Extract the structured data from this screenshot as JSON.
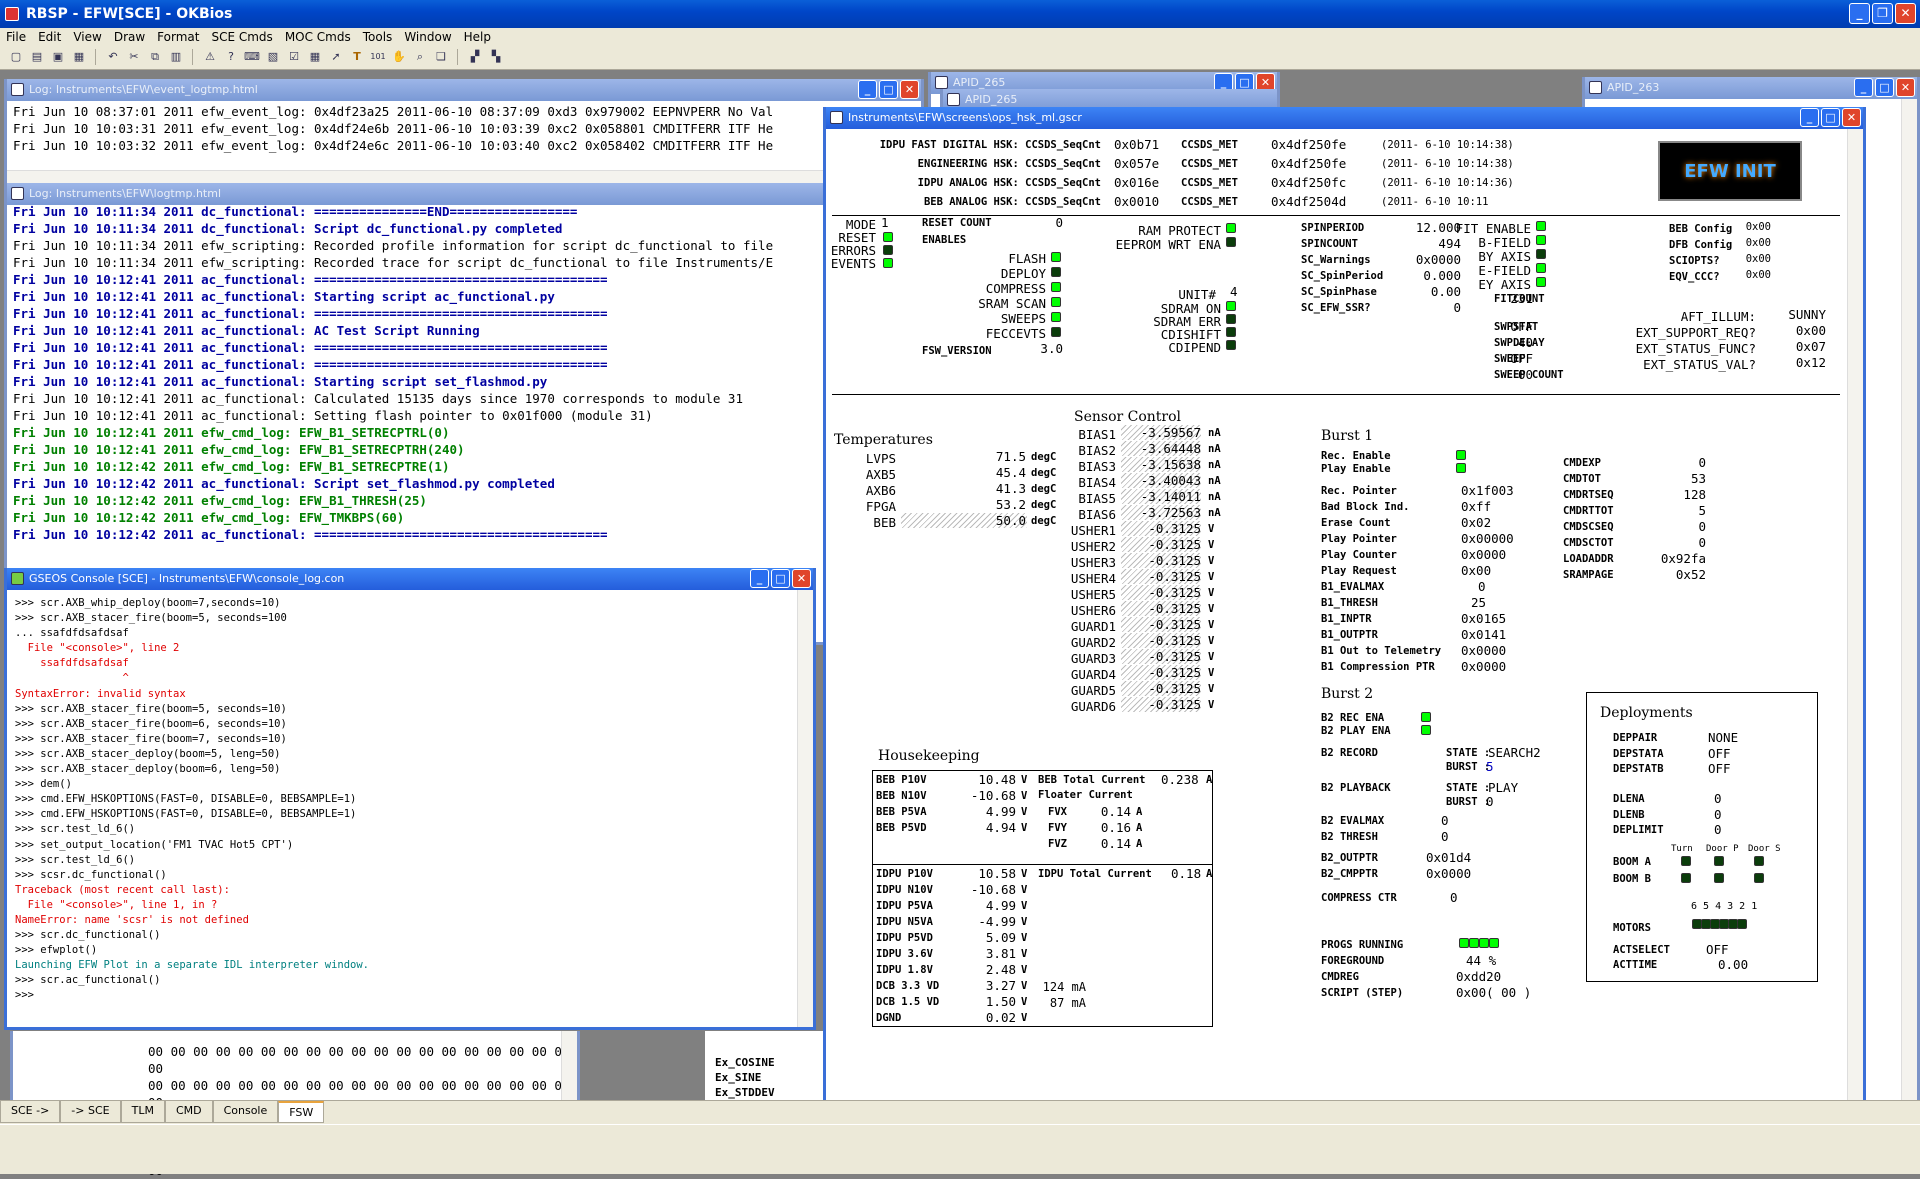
{
  "app": {
    "title": "RBSP - EFW[SCE] - OKBios",
    "menu": [
      "File",
      "Edit",
      "View",
      "Draw",
      "Format",
      "SCE Cmds",
      "MOC Cmds",
      "Tools",
      "Window",
      "Help"
    ]
  },
  "tabs": [
    "SCE ->",
    "-> SCE",
    "TLM",
    "CMD",
    "Console",
    "FSW"
  ],
  "event_log": {
    "title": "Log: Instruments\\EFW\\event_logtmp.html",
    "lines": [
      "Fri Jun 10 08:37:01 2011 efw_event_log: 0x4df23a25 2011-06-10 08:37:09 0xd3 0x979002 EEPNVPERR No Val",
      "Fri Jun 10 10:03:31 2011 efw_event_log: 0x4df24e6b 2011-06-10 10:03:39 0xc2 0x058801 CMDITFERR ITF He",
      "Fri Jun 10 10:03:32 2011 efw_event_log: 0x4df24e6c 2011-06-10 10:03:40 0xc2 0x058402 CMDITFERR ITF He"
    ]
  },
  "logtmp": {
    "title": "Log: Instruments\\EFW\\logtmp.html",
    "lines": [
      {
        "c": "blue",
        "t": "Fri Jun 10 10:11:34 2011 dc_functional: ===============END================="
      },
      {
        "c": "blue",
        "t": "Fri Jun 10 10:11:34 2011 dc_functional: Script dc_functional.py completed"
      },
      {
        "c": "blk",
        "t": "Fri Jun 10 10:11:34 2011 efw_scripting: Recorded profile information for script dc_functional to file"
      },
      {
        "c": "blk",
        "t": "Fri Jun 10 10:11:34 2011 efw_scripting: Recorded trace for script dc_functional to file Instruments/E"
      },
      {
        "c": "blue",
        "t": "Fri Jun 10 10:12:41 2011 ac_functional: ======================================="
      },
      {
        "c": "blue",
        "t": "Fri Jun 10 10:12:41 2011 ac_functional: Starting script ac_functional.py"
      },
      {
        "c": "blue",
        "t": "Fri Jun 10 10:12:41 2011 ac_functional: ======================================="
      },
      {
        "c": "blue",
        "t": "Fri Jun 10 10:12:41 2011 ac_functional: AC Test Script Running"
      },
      {
        "c": "blue",
        "t": "Fri Jun 10 10:12:41 2011 ac_functional: ======================================="
      },
      {
        "c": "blue",
        "t": "Fri Jun 10 10:12:41 2011 ac_functional: ======================================="
      },
      {
        "c": "blue",
        "t": "Fri Jun 10 10:12:41 2011 ac_functional: Starting script set_flashmod.py"
      },
      {
        "c": "blk",
        "t": "Fri Jun 10 10:12:41 2011 ac_functional: Calculated 15135 days since 1970 corresponds to module 31"
      },
      {
        "c": "blk",
        "t": "Fri Jun 10 10:12:41 2011 ac_functional: Setting flash pointer to 0x01f000 (module 31)"
      },
      {
        "c": "green",
        "t": "Fri Jun 10 10:12:41 2011 efw_cmd_log: EFW_B1_SETRECPTRL(0)"
      },
      {
        "c": "green",
        "t": "Fri Jun 10 10:12:41 2011 efw_cmd_log: EFW_B1_SETRECPTRH(240)"
      },
      {
        "c": "green",
        "t": "Fri Jun 10 10:12:42 2011 efw_cmd_log: EFW_B1_SETRECPTRE(1)"
      },
      {
        "c": "blue",
        "t": "Fri Jun 10 10:12:42 2011 ac_functional: Script set_flashmod.py completed"
      },
      {
        "c": "green",
        "t": "Fri Jun 10 10:12:42 2011 efw_cmd_log: EFW_B1_THRESH(25)"
      },
      {
        "c": "green",
        "t": "Fri Jun 10 10:12:42 2011 efw_cmd_log: EFW_TMKBPS(60)"
      },
      {
        "c": "blue",
        "t": "Fri Jun 10 10:12:42 2011 ac_functional: ======================================="
      }
    ]
  },
  "console": {
    "title": "GSEOS Console  [SCE] - Instruments\\EFW\\console_log.con",
    "lines": [
      {
        "c": "blk",
        "t": ">>> scr.AXB_whip_deploy(boom=7,seconds=10)"
      },
      {
        "c": "blk",
        "t": ">>> scr.AXB_stacer_fire(boom=5, seconds=100"
      },
      {
        "c": "blk",
        "t": "... ssafdfdsafdsaf"
      },
      {
        "c": "red",
        "t": "  File \"<console>\", line 2"
      },
      {
        "c": "red",
        "t": "    ssafdfdsafdsaf"
      },
      {
        "c": "red",
        "t": "                 ^"
      },
      {
        "c": "red",
        "t": "SyntaxError: invalid syntax"
      },
      {
        "c": "blk",
        "t": ">>> scr.AXB_stacer_fire(boom=5, seconds=10)"
      },
      {
        "c": "blk",
        "t": ">>> scr.AXB_stacer_fire(boom=6, seconds=10)"
      },
      {
        "c": "blk",
        "t": ">>> scr.AXB_stacer_fire(boom=7, seconds=10)"
      },
      {
        "c": "blk",
        "t": ">>> scr.AXB_stacer_deploy(boom=5, leng=50)"
      },
      {
        "c": "blk",
        "t": ">>> scr.AXB_stacer_deploy(boom=6, leng=50)"
      },
      {
        "c": "blk",
        "t": ">>> dem()"
      },
      {
        "c": "blk",
        "t": ">>> cmd.EFW_HSKOPTIONS(FAST=0, DISABLE=0, BEBSAMPLE=1)"
      },
      {
        "c": "blk",
        "t": ">>> cmd.EFW_HSKOPTIONS(FAST=0, DISABLE=0, BEBSAMPLE=1)"
      },
      {
        "c": "blk",
        "t": ">>> scr.test_ld_6()"
      },
      {
        "c": "blk",
        "t": ">>> set_output_location('FM1 TVAC Hot5 CPT')"
      },
      {
        "c": "blk",
        "t": ">>> scr.test_ld_6()"
      },
      {
        "c": "blk",
        "t": ">>> scsr.dc_functional()"
      },
      {
        "c": "red",
        "t": "Traceback (most recent call last):"
      },
      {
        "c": "red",
        "t": "  File \"<console>\", line 1, in ?"
      },
      {
        "c": "red",
        "t": "NameError: name 'scsr' is not defined"
      },
      {
        "c": "blk",
        "t": ">>> scr.dc_functional()"
      },
      {
        "c": "blk",
        "t": ">>> efwplot()"
      },
      {
        "c": "teal",
        "t": "Launching EFW Plot in a separate IDL interpreter window."
      },
      {
        "c": "blk",
        "t": ">>> scr.ac_functional()"
      },
      {
        "c": "blk",
        "t": ">>>"
      }
    ]
  },
  "hexdump": {
    "rows": [
      "00 00 00 00 00 00 00 00 00 00 00 00 00 00 00 00 00 00 00 00",
      "00 00 00 00 00 00 00 00 00 00 00 00 00 00 00 00 00 00 00 00",
      "00 00 00 00 00 00 00 00 00 00 00 00 00 00 00 00 00 00 00 00",
      "00 00 00 00 00 00 00 00 00 00 00 00 00 00 00 00 00 00 00 00"
    ],
    "side": [
      "Ex_COSINE",
      "Ex_SINE",
      "Ex_STDDEV"
    ]
  },
  "apid": {
    "a265": "APID_265",
    "a265b": "APID_265",
    "a263": "APID_263"
  },
  "screen": {
    "title": "Instruments\\EFW\\screens\\ops_hsk_ml.gscr",
    "hsk": [
      {
        "l": "IDPU FAST DIGITAL HSK: CCSDS_SeqCnt",
        "v": "0x0b71",
        "m": "0x4df250fe",
        "d": "(2011- 6-10  10:14:38)"
      },
      {
        "l": "ENGINEERING HSK: CCSDS_SeqCnt",
        "v": "0x057e",
        "m": "0x4df250fe",
        "d": "(2011- 6-10  10:14:38)"
      },
      {
        "l": "IDPU ANALOG HSK: CCSDS_SeqCnt",
        "v": "0x016e",
        "m": "0x4df250fc",
        "d": "(2011- 6-10  10:14:36)"
      },
      {
        "l": "BEB ANALOG HSK: CCSDS_SeqCnt",
        "v": "0x0010",
        "m": "0x4df2504d",
        "d": "(2011- 6-10  10:11"
      }
    ],
    "met_label": "CCSDS_MET",
    "logo": "EFW INIT",
    "mode": {
      "MODE": "1",
      "RESET": "",
      "ERRORS": "",
      "EVENTS": ""
    },
    "reset_count": "0",
    "fsw_version": "3.0",
    "enables": [
      "FLASH",
      "DEPLOY",
      "COMPRESS",
      "SRAM SCAN",
      "SWEEPS",
      "FECCEVTS"
    ],
    "ram_protect": "RAM PROTECT",
    "eeprom": "EEPROM WRT ENA",
    "unit": "4",
    "sdram": [
      "SDRAM ON",
      "SDRAM ERR",
      "CDISHIFT",
      "CDIPEND"
    ],
    "spin": [
      {
        "l": "SPINPERIOD",
        "v": "12.000"
      },
      {
        "l": "SPINCOUNT",
        "v": "494"
      },
      {
        "l": "SC_Warnings",
        "v": "0x0000"
      },
      {
        "l": "SC_SpinPeriod",
        "v": "0.000"
      },
      {
        "l": "SC_SpinPhase",
        "v": "0.00"
      },
      {
        "l": "SC_EFW_SSR?",
        "v": "0"
      }
    ],
    "fit": [
      "FIT ENABLE",
      "B-FIELD",
      "BY AXIS",
      "E-FIELD",
      "EY AXIS"
    ],
    "fitcount": "231",
    "sweep": [
      {
        "l": "SWPSTAT",
        "v": "OFF"
      },
      {
        "l": "SWPDELAY",
        "v": "40"
      },
      {
        "l": "SWEEP",
        "v": "OFF"
      },
      {
        "l": "SWEEP COUNT",
        "v": "00"
      }
    ],
    "beb": [
      {
        "l": "BEB Config",
        "v": "0x00"
      },
      {
        "l": "DFB Config",
        "v": "0x00"
      },
      {
        "l": "SCIOPTS?",
        "v": "0x00"
      },
      {
        "l": "EQV_CCC?",
        "v": "0x00"
      }
    ],
    "ext": [
      {
        "l": "AFT_ILLUM:",
        "v": "SUNNY"
      },
      {
        "l": "EXT_SUPPORT_REQ?",
        "v": "0x00"
      },
      {
        "l": "EXT_STATUS_FUNC?",
        "v": "0x07"
      },
      {
        "l": "EXT_STATUS_VAL?",
        "v": "0x12"
      }
    ],
    "temps_hdr": "Temperatures",
    "temps": [
      {
        "l": "LVPS",
        "v": "71.5",
        "u": "degC"
      },
      {
        "l": "AXB5",
        "v": "45.4",
        "u": "degC"
      },
      {
        "l": "AXB6",
        "v": "41.3",
        "u": "degC"
      },
      {
        "l": "FPGA",
        "v": "53.2",
        "u": "degC"
      },
      {
        "l": "BEB",
        "v": "50.0",
        "u": "degC"
      }
    ],
    "sensor_hdr": "Sensor Control",
    "sensor": [
      {
        "l": "BIAS1",
        "v": "-3.59567",
        "u": "nA"
      },
      {
        "l": "BIAS2",
        "v": "-3.64448",
        "u": "nA"
      },
      {
        "l": "BIAS3",
        "v": "-3.15638",
        "u": "nA"
      },
      {
        "l": "BIAS4",
        "v": "-3.40043",
        "u": "nA"
      },
      {
        "l": "BIAS5",
        "v": "-3.14011",
        "u": "nA"
      },
      {
        "l": "BIAS6",
        "v": "-3.72563",
        "u": "nA"
      },
      {
        "l": "USHER1",
        "v": "-0.3125",
        "u": "V"
      },
      {
        "l": "USHER2",
        "v": "-0.3125",
        "u": "V"
      },
      {
        "l": "USHER3",
        "v": "-0.3125",
        "u": "V"
      },
      {
        "l": "USHER4",
        "v": "-0.3125",
        "u": "V"
      },
      {
        "l": "USHER5",
        "v": "-0.3125",
        "u": "V"
      },
      {
        "l": "USHER6",
        "v": "-0.3125",
        "u": "V"
      },
      {
        "l": "GUARD1",
        "v": "-0.3125",
        "u": "V"
      },
      {
        "l": "GUARD2",
        "v": "-0.3125",
        "u": "V"
      },
      {
        "l": "GUARD3",
        "v": "-0.3125",
        "u": "V"
      },
      {
        "l": "GUARD4",
        "v": "-0.3125",
        "u": "V"
      },
      {
        "l": "GUARD5",
        "v": "-0.3125",
        "u": "V"
      },
      {
        "l": "GUARD6",
        "v": "-0.3125",
        "u": "V"
      }
    ],
    "hk_hdr": "Housekeeping",
    "hk_beb": [
      {
        "l": "BEB P10V",
        "v": "10.48",
        "u": "V"
      },
      {
        "l": "BEB N10V",
        "v": "-10.68",
        "u": "V"
      },
      {
        "l": "BEB P5VA",
        "v": "4.99",
        "u": "V"
      },
      {
        "l": "BEB P5VD",
        "v": "4.94",
        "u": "V"
      }
    ],
    "beb_total": {
      "l": "BEB Total Current",
      "v": "0.238",
      "u": "A"
    },
    "floater": "Floater Current",
    "floater_vals": [
      {
        "l": "FVX",
        "v": "0.14",
        "u": "A"
      },
      {
        "l": "FVY",
        "v": "0.16",
        "u": "A"
      },
      {
        "l": "FVZ",
        "v": "0.14",
        "u": "A"
      }
    ],
    "hk_idpu": [
      {
        "l": "IDPU P10V",
        "v": "10.58",
        "u": "V"
      },
      {
        "l": "IDPU N10V",
        "v": "-10.68",
        "u": "V"
      },
      {
        "l": "IDPU P5VA",
        "v": "4.99",
        "u": "V"
      },
      {
        "l": "IDPU N5VA",
        "v": "-4.99",
        "u": "V"
      },
      {
        "l": "IDPU P5VD",
        "v": "5.09",
        "u": "V"
      },
      {
        "l": "IDPU 3.6V",
        "v": "3.81",
        "u": "V"
      },
      {
        "l": "IDPU 1.8V",
        "v": "2.48",
        "u": "V"
      },
      {
        "l": "DCB 3.3 VD",
        "v": "3.27",
        "u": "V"
      },
      {
        "l": "DCB 1.5 VD",
        "v": "1.50",
        "u": "V"
      },
      {
        "l": "DGND",
        "v": "0.02",
        "u": "V"
      }
    ],
    "idpu_total": {
      "l": "IDPU Total Current",
      "v": "0.18",
      "u": "A"
    },
    "dcb_ma": [
      "124 mA",
      "87 mA"
    ],
    "burst1_hdr": "Burst 1",
    "burst1_en": [
      "Rec. Enable",
      "Play Enable"
    ],
    "burst1": [
      {
        "l": "Rec. Pointer",
        "v": "0x1f003"
      },
      {
        "l": "Bad Block Ind.",
        "v": "0xff"
      },
      {
        "l": "Erase Count",
        "v": "0x02"
      },
      {
        "l": "Play Pointer",
        "v": "0x00000"
      },
      {
        "l": "Play Counter",
        "v": "0x0000"
      },
      {
        "l": "Play Request",
        "v": "0x00"
      },
      {
        "l": "B1_EVALMAX",
        "v": "0"
      },
      {
        "l": "B1_THRESH",
        "v": "25"
      },
      {
        "l": "B1_INPTR",
        "v": "0x0165"
      },
      {
        "l": "B1_OUTPTR",
        "v": "0x0141"
      },
      {
        "l": "B1 Out to Telemetry",
        "v": "0x0000"
      },
      {
        "l": "B1 Compression PTR",
        "v": "0x0000"
      }
    ],
    "cmd": [
      {
        "l": "CMDEXP",
        "v": "0"
      },
      {
        "l": "CMDTOT",
        "v": "53"
      },
      {
        "l": "CMDRTSEQ",
        "v": "128"
      },
      {
        "l": "CMDRTTOT",
        "v": "5"
      },
      {
        "l": "CMDSCSEQ",
        "v": "0"
      },
      {
        "l": "CMDSCTOT",
        "v": "0"
      },
      {
        "l": "LOADADDR",
        "v": "0x92fa"
      },
      {
        "l": "SRAMPAGE",
        "v": "0x52"
      }
    ],
    "burst2_hdr": "Burst 2",
    "burst2_en": [
      "B2 REC ENA",
      "B2 PLAY ENA"
    ],
    "b2record": {
      "l": "B2 RECORD",
      "state_l": "STATE :",
      "state": "SEARCH2",
      "burst_l": "BURST :",
      "burst": "5"
    },
    "b2playback": {
      "l": "B2 PLAYBACK",
      "state_l": "STATE :",
      "state": "PLAY",
      "burst_l": "BURST :",
      "burst": "0"
    },
    "b2": [
      {
        "l": "B2 EVALMAX",
        "v": "0"
      },
      {
        "l": "B2 THRESH",
        "v": "0"
      }
    ],
    "b2ptr": [
      {
        "l": "B2_OUTPTR",
        "v": "0x01d4"
      },
      {
        "l": "B2_CMPPTR",
        "v": "0x0000"
      }
    ],
    "compress_ctr": {
      "l": "COMPRESS CTR",
      "v": "0"
    },
    "progs": {
      "l": "PROGS RUNNING"
    },
    "fg": {
      "l": "FOREGROUND",
      "v": "44 %"
    },
    "cmdreg": {
      "l": "CMDREG",
      "v": "0xdd20"
    },
    "script": {
      "l": "SCRIPT (STEP)",
      "v": "0x00( 00 )"
    },
    "deploy_hdr": "Deployments",
    "deploy": [
      {
        "l": "DEPPAIR",
        "v": "NONE"
      },
      {
        "l": "DEPSTATA",
        "v": "OFF"
      },
      {
        "l": "DEPSTATB",
        "v": "OFF"
      },
      {
        "l": "DLENA",
        "v": "0"
      },
      {
        "l": "DLENB",
        "v": "0"
      },
      {
        "l": "DEPLIMIT",
        "v": "0"
      }
    ],
    "boom_cols": [
      "Turn",
      "Door P",
      "Door S"
    ],
    "booms": [
      "BOOM A",
      "BOOM B"
    ],
    "motors": {
      "l": "MOTORS",
      "nums": "6 5 4 3 2 1"
    },
    "actselect": {
      "l": "ACTSELECT",
      "v": "OFF"
    },
    "acttime": {
      "l": "ACTTIME",
      "v": "0.00"
    }
  }
}
